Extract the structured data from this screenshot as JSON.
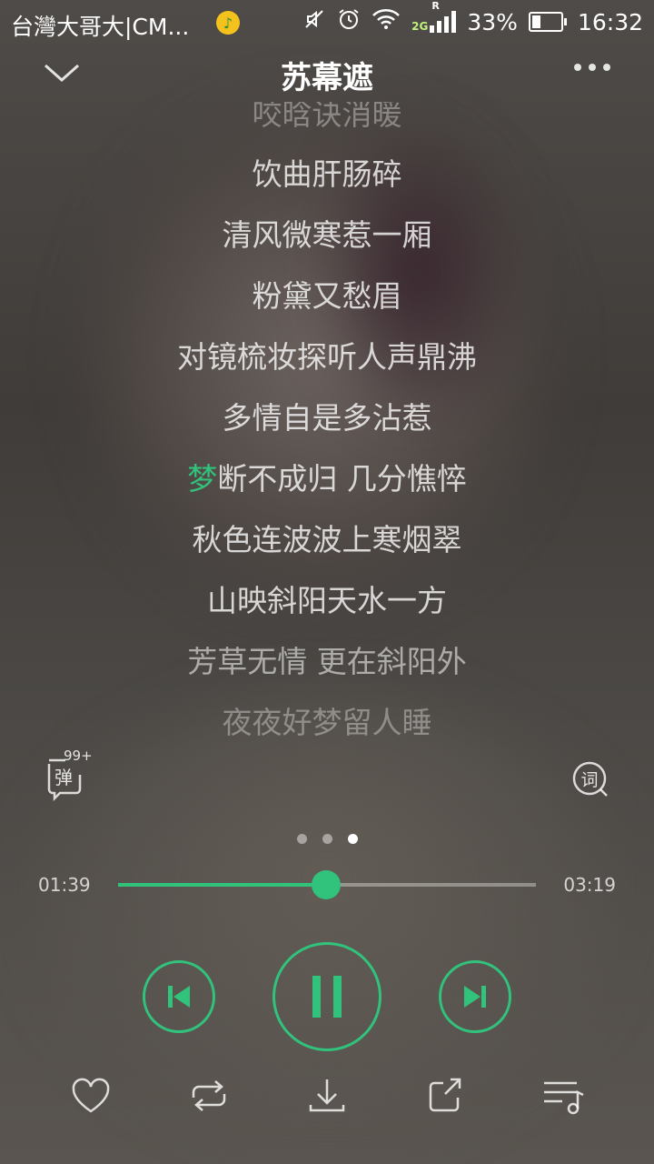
{
  "status_bar": {
    "carrier": "台灣大哥大|CM...",
    "network": "2G",
    "roaming": "R",
    "battery": "33%",
    "battery_level": 0.33,
    "time": "16:32"
  },
  "header": {
    "title": "苏幕遮"
  },
  "lyrics": {
    "lines": [
      "咬晗诀消暖",
      "饮曲肝肠碎",
      "清风微寒惹一厢",
      "粉黛又愁眉",
      "对镜梳妆探听人声鼎沸",
      "多情自是多沾惹",
      "断不成归 几分憔悴",
      "秋色连波波上寒烟翠",
      "山映斜阳天水一方",
      "芳草无情 更在斜阳外",
      "夜夜好梦留人睡"
    ],
    "current_highlight": "梦",
    "current_index": 6
  },
  "danmu": {
    "label": "弹",
    "count": "99+"
  },
  "lyric_button": {
    "label": "词"
  },
  "pager": {
    "total": 3,
    "active": 2
  },
  "player": {
    "current_time": "01:39",
    "total_time": "03:19",
    "progress": 0.497
  },
  "colors": {
    "accent": "#31c27c"
  },
  "icons": {
    "back": "chevron-down-icon",
    "more": "more-dots-icon",
    "prev": "skip-previous-icon",
    "pause": "pause-icon",
    "next": "skip-next-icon",
    "like": "heart-icon",
    "repeat": "repeat-icon",
    "download": "download-icon",
    "share": "share-icon",
    "playlist": "playlist-icon"
  }
}
